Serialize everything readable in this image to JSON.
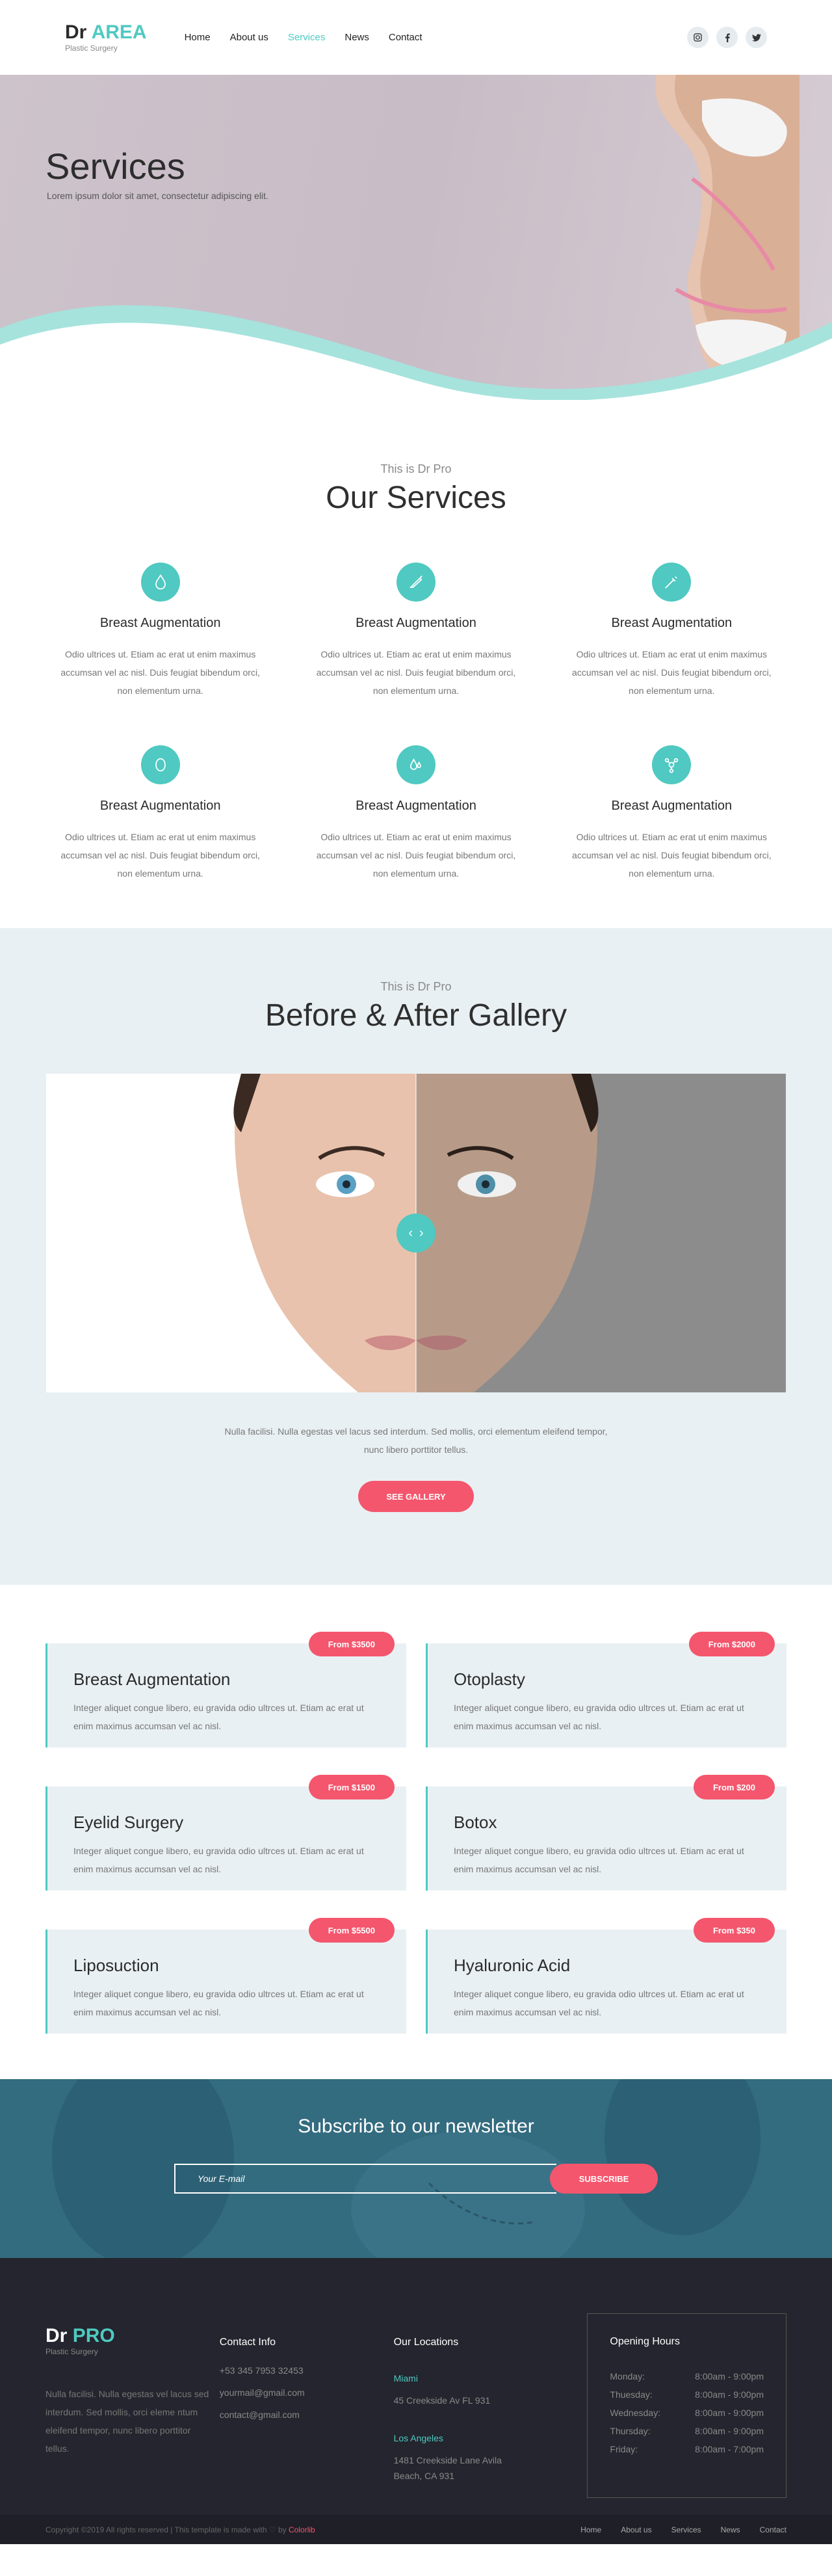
{
  "brand": {
    "dr": "Dr",
    "name": "AREA",
    "sub": "Plastic Surgery"
  },
  "nav": [
    {
      "label": "Home"
    },
    {
      "label": "About us"
    },
    {
      "label": "Services",
      "active": true
    },
    {
      "label": "News"
    },
    {
      "label": "Contact"
    }
  ],
  "social": [
    {
      "icon": "instagram-icon",
      "glyph": "◎"
    },
    {
      "icon": "facebook-icon",
      "glyph": "f"
    },
    {
      "icon": "twitter-icon",
      "glyph": "t"
    }
  ],
  "hero": {
    "title": "Services",
    "subtitle": "Lorem ipsum dolor sit amet, consectetur adipiscing elit."
  },
  "services": {
    "kicker": "This is Dr Pro",
    "title": "Our Services",
    "items": [
      {
        "icon": "drop-icon",
        "title": "Breast Augmentation",
        "text": "Odio ultrices ut. Etiam ac erat ut enim maximus accumsan vel ac nisl. Duis feugiat bibendum orci, non elementum urna."
      },
      {
        "icon": "scalpel-icon",
        "title": "Breast Augmentation",
        "text": "Odio ultrices ut. Etiam ac erat ut enim maximus accumsan vel ac nisl. Duis feugiat bibendum orci, non elementum urna."
      },
      {
        "icon": "syringe-icon",
        "title": "Breast Augmentation",
        "text": "Odio ultrices ut. Etiam ac erat ut enim maximus accumsan vel ac nisl. Duis feugiat bibendum orci, non elementum urna."
      },
      {
        "icon": "face-icon",
        "title": "Breast Augmentation",
        "text": "Odio ultrices ut. Etiam ac erat ut enim maximus accumsan vel ac nisl. Duis feugiat bibendum orci, non elementum urna."
      },
      {
        "icon": "drops-icon",
        "title": "Breast Augmentation",
        "text": "Odio ultrices ut. Etiam ac erat ut enim maximus accumsan vel ac nisl. Duis feugiat bibendum orci, non elementum urna."
      },
      {
        "icon": "molecule-icon",
        "title": "Breast Augmentation",
        "text": "Odio ultrices ut. Etiam ac erat ut enim maximus accumsan vel ac nisl. Duis feugiat bibendum orci, non elementum urna."
      }
    ]
  },
  "gallery": {
    "kicker": "This is Dr Pro",
    "title": "Before & After Gallery",
    "text": "Nulla facilisi. Nulla egestas vel lacus sed interdum. Sed mollis, orci elementum eleifend tempor, nunc libero porttitor tellus.",
    "button": "SEE GALLERY"
  },
  "prices": [
    {
      "badge": "From $3500",
      "title": "Breast Augmentation",
      "text": "Integer aliquet congue libero, eu gravida odio ultrces ut. Etiam ac erat ut enim maximus accumsan vel ac nisl."
    },
    {
      "badge": "From $2000",
      "title": "Otoplasty",
      "text": "Integer aliquet congue libero, eu gravida odio ultrces ut. Etiam ac erat ut enim maximus accumsan vel ac nisl."
    },
    {
      "badge": "From $1500",
      "title": "Eyelid Surgery",
      "text": "Integer aliquet congue libero, eu gravida odio ultrces ut. Etiam ac erat ut enim maximus accumsan vel ac nisl."
    },
    {
      "badge": "From $200",
      "title": "Botox",
      "text": "Integer aliquet congue libero, eu gravida odio ultrces ut. Etiam ac erat ut enim maximus accumsan vel ac nisl."
    },
    {
      "badge": "From $5500",
      "title": "Liposuction",
      "text": "Integer aliquet congue libero, eu gravida odio ultrces ut. Etiam ac erat ut enim maximus accumsan vel ac nisl."
    },
    {
      "badge": "From $350",
      "title": "Hyaluronic Acid",
      "text": "Integer aliquet congue libero, eu gravida odio ultrces ut. Etiam ac erat ut enim maximus accumsan vel ac nisl."
    }
  ],
  "newsletter": {
    "title": "Subscribe to our newsletter",
    "placeholder": "Your E-mail",
    "button": "SUBSCRIBE"
  },
  "footer": {
    "brand": {
      "dr": "Dr",
      "name": "PRO",
      "sub": "Plastic Surgery"
    },
    "about": "Nulla facilisi. Nulla egestas vel lacus sed interdum. Sed mollis, orci eleme ntum eleifend tempor, nunc libero porttitor tellus.",
    "contact": {
      "heading": "Contact Info",
      "phone": "+53 345 7953 32453",
      "email1": "yourmail@gmail.com",
      "email2": "contact@gmail.com"
    },
    "locations": {
      "heading": "Our Locations",
      "items": [
        {
          "city": "Miami",
          "address": "45 Creekside Av FL 931"
        },
        {
          "city": "Los Angeles",
          "address": "1481 Creekside Lane Avila Beach, CA 931"
        }
      ]
    },
    "hours": {
      "heading": "Opening Hours",
      "rows": [
        {
          "day": "Monday:",
          "time": "8:00am - 9:00pm"
        },
        {
          "day": "Thuesday:",
          "time": "8:00am - 9:00pm"
        },
        {
          "day": "Wednesday:",
          "time": "8:00am - 9:00pm"
        },
        {
          "day": "Thursday:",
          "time": "8:00am - 9:00pm"
        },
        {
          "day": "Friday:",
          "time": "8:00am - 7:00pm"
        }
      ]
    },
    "copyright": "Copyright ©2019 All rights reserved | This template is made with ♡ by",
    "copyright_brand": "Colorlib",
    "links": [
      {
        "label": "Home"
      },
      {
        "label": "About us"
      },
      {
        "label": "Services"
      },
      {
        "label": "News"
      },
      {
        "label": "Contact"
      }
    ]
  },
  "colors": {
    "accent": "#4fc9c1",
    "cta": "#f4566d",
    "dark": "#24252e",
    "light_bg": "#e9f0f3"
  }
}
